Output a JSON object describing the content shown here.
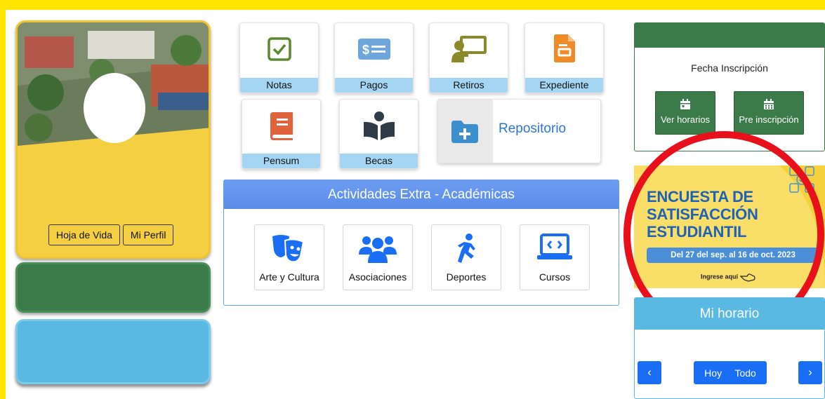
{
  "profile": {
    "buttons": [
      "Hoja de Vida",
      "Mi Perfil"
    ]
  },
  "tiles": {
    "notas": "Notas",
    "pagos": "Pagos",
    "retiros": "Retiros",
    "expediente": "Expediente",
    "pensum": "Pensum",
    "becas": "Becas",
    "repositorio": "Repositorio"
  },
  "activities": {
    "title": "Actividades Extra - Académicas",
    "items": [
      "Arte y Cultura",
      "Asociaciones",
      "Deportes",
      "Cursos"
    ]
  },
  "inscripcion": {
    "title": "Fecha Inscripción",
    "ver_horarios": "Ver horarios",
    "pre_inscripcion": "Pre inscripción"
  },
  "banner": {
    "line1": "ENCUESTA DE",
    "line2": "SATISFACCIÓN",
    "line3": "ESTUDIANTIL",
    "dates": "Del 27 del sep. al 16 de oct. 2023",
    "cta": "Ingrese aquí"
  },
  "horario": {
    "title": "Mi horario",
    "prev": "‹",
    "next": "›",
    "hoy": "Hoy",
    "todo": "Todo"
  },
  "colors": {
    "page_border": "#ffe600",
    "green": "#3b7a49",
    "light_blue": "#5ab9e3",
    "tile_label": "#a4d6f3",
    "activities_header": "#5a8ce9",
    "primary_blue": "#1a6ef5",
    "highlight_ring": "#e8101a"
  }
}
